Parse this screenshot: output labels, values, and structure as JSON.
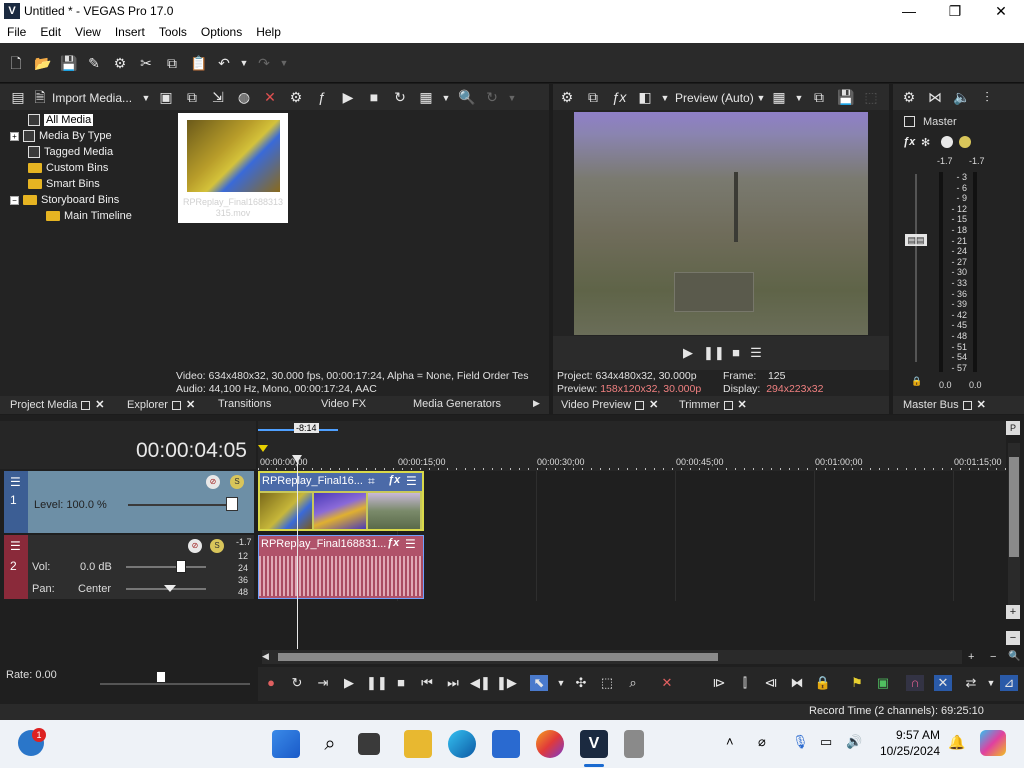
{
  "window": {
    "title": "Untitled * - VEGAS Pro 17.0",
    "app_icon": "V"
  },
  "menu": [
    "File",
    "Edit",
    "View",
    "Insert",
    "Tools",
    "Options",
    "Help"
  ],
  "project_media": {
    "import_label": "Import Media...",
    "tree": [
      "All Media",
      "Media By Type",
      "Tagged Media",
      "Custom Bins",
      "Smart Bins",
      "Storyboard Bins",
      "Main Timeline"
    ],
    "thumb_caption": "RPReplay_Final1688313315.mov",
    "info_video": "Video: 634x480x32, 30.000 fps, 00:00:17:24, Alpha = None, Field Order Tes",
    "info_audio": "Audio: 44,100 Hz, Mono, 00:00:17:24, AAC"
  },
  "preview": {
    "mode": "Preview (Auto)",
    "project_label": "Project:",
    "project_value": "634x480x32, 30.000p",
    "preview_label": "Preview:",
    "preview_value": "158x120x32, 30.000p",
    "frame_label": "Frame:",
    "frame_value": "125",
    "display_label": "Display:",
    "display_value": "294x223x32"
  },
  "master": {
    "label": "Master",
    "peak_left": "-1.7",
    "peak_right": "-1.7",
    "scale": [
      "3",
      "6",
      "9",
      "12",
      "15",
      "18",
      "21",
      "24",
      "27",
      "30",
      "33",
      "36",
      "39",
      "42",
      "45",
      "48",
      "51",
      "54",
      "57"
    ],
    "level_left": "0.0",
    "level_right": "0.0"
  },
  "tabs": {
    "project_media": "Project Media",
    "explorer": "Explorer",
    "transitions": "Transitions",
    "video_fx": "Video FX",
    "media_generators": "Media Generators",
    "video_preview": "Video Preview",
    "trimmer": "Trimmer",
    "master_bus": "Master Bus"
  },
  "timeline": {
    "timecode": "00:00:04:05",
    "loop_label": "-8:14",
    "ruler": [
      "00:00:00;00",
      "00:00:15;00",
      "00:00:30;00",
      "00:00:45;00",
      "00:01:00;00",
      "00:01:15;00"
    ],
    "video_track": {
      "number": "1",
      "level": "Level: 100.0 %",
      "clip": "RPReplay_Final16..."
    },
    "audio_track": {
      "number": "2",
      "vol_label": "Vol:",
      "vol_value": "0.0 dB",
      "pan_label": "Pan:",
      "pan_value": "Center",
      "clip": "RPReplay_Final168831...",
      "peak": "-1.7",
      "scale": [
        "12",
        "24",
        "36",
        "48"
      ]
    },
    "rate": "Rate: 0.00"
  },
  "status": {
    "record_time": "Record Time (2 channels): 69:25:10"
  },
  "taskbar": {
    "time": "9:57 AM",
    "date": "10/25/2024",
    "badge": "1"
  }
}
